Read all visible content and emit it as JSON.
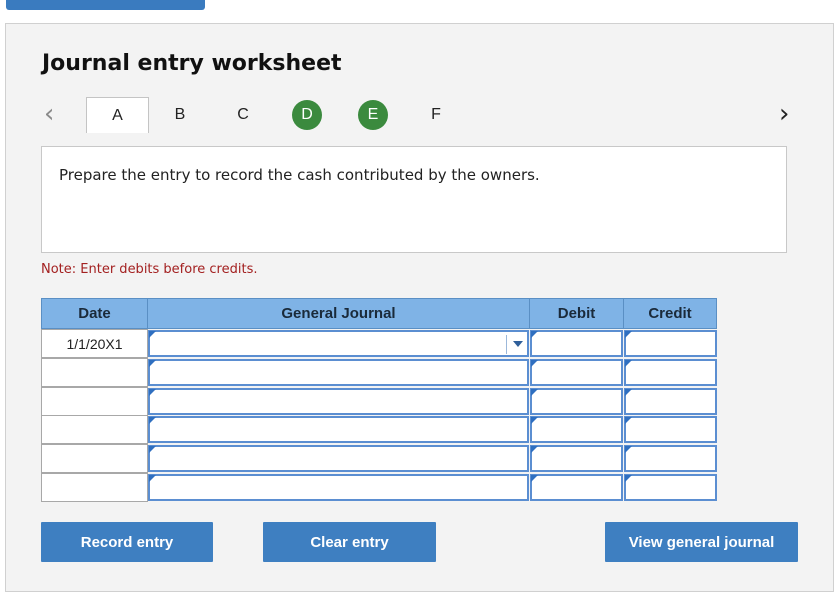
{
  "worksheet": {
    "title": "Journal entry worksheet",
    "tabs": [
      {
        "label": "A",
        "state": "active"
      },
      {
        "label": "B",
        "state": "plain"
      },
      {
        "label": "C",
        "state": "plain"
      },
      {
        "label": "D",
        "state": "completed"
      },
      {
        "label": "E",
        "state": "completed"
      },
      {
        "label": "F",
        "state": "plain"
      }
    ],
    "prev_icon": "chevron-left-icon",
    "next_icon": "chevron-right-icon",
    "instruction": "Prepare the entry to record the cash contributed by the owners.",
    "note": "Note: Enter debits before credits.",
    "note_color": "#a32020",
    "completed_tab_color": "#3b8a3e"
  },
  "journal_table": {
    "headers": {
      "date": "Date",
      "general_journal": "General Journal",
      "debit": "Debit",
      "credit": "Credit"
    },
    "header_color": "#7fb3e6",
    "rows": [
      {
        "date": "1/1/20X1",
        "account": "",
        "debit": "",
        "credit": ""
      },
      {
        "date": "",
        "account": "",
        "debit": "",
        "credit": ""
      },
      {
        "date": "",
        "account": "",
        "debit": "",
        "credit": ""
      },
      {
        "date": "",
        "account": "",
        "debit": "",
        "credit": ""
      },
      {
        "date": "",
        "account": "",
        "debit": "",
        "credit": ""
      },
      {
        "date": "",
        "account": "",
        "debit": "",
        "credit": ""
      }
    ]
  },
  "buttons": {
    "record": "Record entry",
    "clear": "Clear entry",
    "view": "View general journal",
    "color": "#3e7fc1"
  }
}
